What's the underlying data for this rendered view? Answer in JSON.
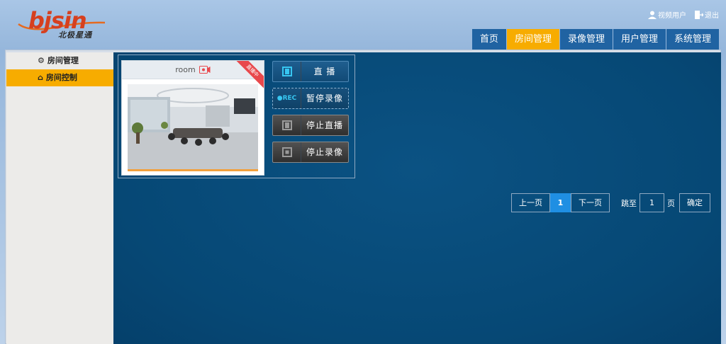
{
  "brand": {
    "name": "bjsin",
    "subtitle": "北极星通"
  },
  "user": {
    "name": "视频用户",
    "logout": "退出"
  },
  "nav": {
    "tabs": [
      {
        "label": "首页",
        "active": false
      },
      {
        "label": "房间管理",
        "active": true
      },
      {
        "label": "录像管理",
        "active": false
      },
      {
        "label": "用户管理",
        "active": false
      },
      {
        "label": "系统管理",
        "active": false
      }
    ]
  },
  "sidebar": {
    "items": [
      {
        "label": "房间管理",
        "icon": "gear-icon",
        "active": false
      },
      {
        "label": "房间控制",
        "icon": "home-icon",
        "active": true
      }
    ]
  },
  "room": {
    "name": "room",
    "status_ribbon": "直播中",
    "buttons": [
      {
        "icon": "film-icon",
        "label": "直 播",
        "style": "blue"
      },
      {
        "icon": "rec-icon",
        "icon_text": "●REC",
        "label": "暂停录像",
        "style": "rec"
      },
      {
        "icon": "film-icon",
        "label": "停止直播",
        "style": "grey"
      },
      {
        "icon": "stop-icon",
        "label": "停止录像",
        "style": "grey"
      }
    ]
  },
  "pagination": {
    "prev": "上一页",
    "current": "1",
    "next": "下一页",
    "jump_label": "跳至",
    "jump_value": "1",
    "page_unit": "页",
    "confirm": "确定"
  },
  "colors": {
    "accent": "#f7ac00",
    "nav_bg": "#2063a2",
    "main_bg": "#064875",
    "active_page": "#1f8fe3"
  }
}
